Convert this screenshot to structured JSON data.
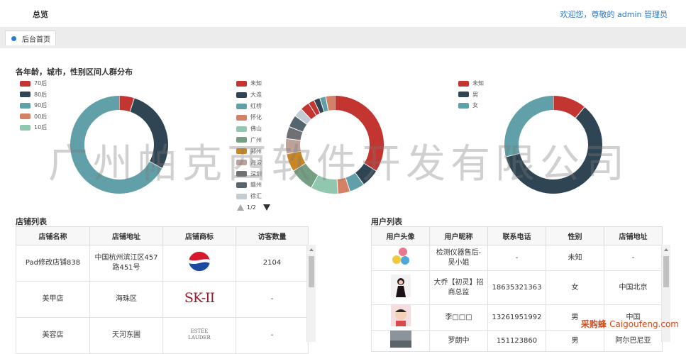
{
  "header": {
    "title": "总览",
    "welcome": "欢迎您，尊敬的 admin 管理员"
  },
  "tabs": [
    {
      "label": "后台首页"
    }
  ],
  "charts_section": {
    "title": "各年龄，城市，性别区间人群分布"
  },
  "pager": {
    "text": "1/2"
  },
  "watermark": "广州帕克西软件开发有限公司",
  "chart_data": [
    {
      "type": "pie",
      "categories": [
        "70后",
        "80后",
        "90后",
        "00后",
        "10后"
      ],
      "values": [
        5,
        28,
        67,
        0,
        0
      ],
      "colors": [
        "#c23531",
        "#2f4554",
        "#61a0a8",
        "#d48265",
        "#91c7ae"
      ]
    },
    {
      "type": "pie",
      "categories": [
        "未知",
        "大连",
        "红桥",
        "怀化",
        "佛山",
        "广州",
        "郑州",
        "海淀",
        "深圳",
        "赣州",
        "徐汇",
        ""
      ],
      "values": [
        34,
        6,
        5,
        4,
        9,
        8,
        6,
        5,
        4,
        4,
        3,
        3,
        2,
        2,
        2,
        3
      ],
      "colors": [
        "#c23531",
        "#2f4554",
        "#61a0a8",
        "#d48265",
        "#91c7ae",
        "#749f83",
        "#ca8622",
        "#bda29a",
        "#6e7074",
        "#546570",
        "#c4ccd3",
        "#c23531"
      ]
    },
    {
      "type": "pie",
      "categories": [
        "未知",
        "男",
        "女"
      ],
      "values": [
        11,
        60,
        29
      ],
      "colors": [
        "#c23531",
        "#2f4554",
        "#61a0a8"
      ]
    }
  ],
  "store_list": {
    "title": "店铺列表",
    "columns": [
      "店铺名称",
      "店铺地址",
      "店铺商标",
      "访客数量"
    ],
    "rows": [
      {
        "name": "Pad修改店铺838",
        "address": "中国杭州滨江区457路451号",
        "logo": "pepsi-logo",
        "visitors": "2104"
      },
      {
        "name": "美甲店",
        "address": "海珠区",
        "logo": "skii-logo",
        "logo_text": "SK-II",
        "visitors": "-"
      },
      {
        "name": "美容店",
        "address": "天河东圃",
        "logo": "estee-lauder-logo",
        "logo_text": "ESTÉE LAUDER",
        "visitors": "-"
      }
    ]
  },
  "user_list": {
    "title": "用户列表",
    "columns": [
      "用户头像",
      "用户昵称",
      "联系电话",
      "性别",
      "店铺地址"
    ],
    "rows": [
      {
        "avatar": "balloons-avatar",
        "nickname": "检测仪器售后-吴小姐",
        "phone": "-",
        "gender": "未知",
        "address": "-"
      },
      {
        "avatar": "woman-avatar",
        "nickname": "大乔【初灵】招商总监",
        "phone": "18635321363",
        "gender": "女",
        "address": "中国北京"
      },
      {
        "avatar": "cartoon-avatar",
        "nickname": "李□□□",
        "phone": "13261951992",
        "gender": "男",
        "address": "中国"
      },
      {
        "avatar": "landscape-avatar",
        "nickname": "罗朗中",
        "phone": "151123860",
        "gender": "男",
        "address": "阿尔巴尼亚"
      }
    ]
  },
  "footer_logo": {
    "brand": "采购蜂",
    "domain": "Caigoufeng.com"
  }
}
